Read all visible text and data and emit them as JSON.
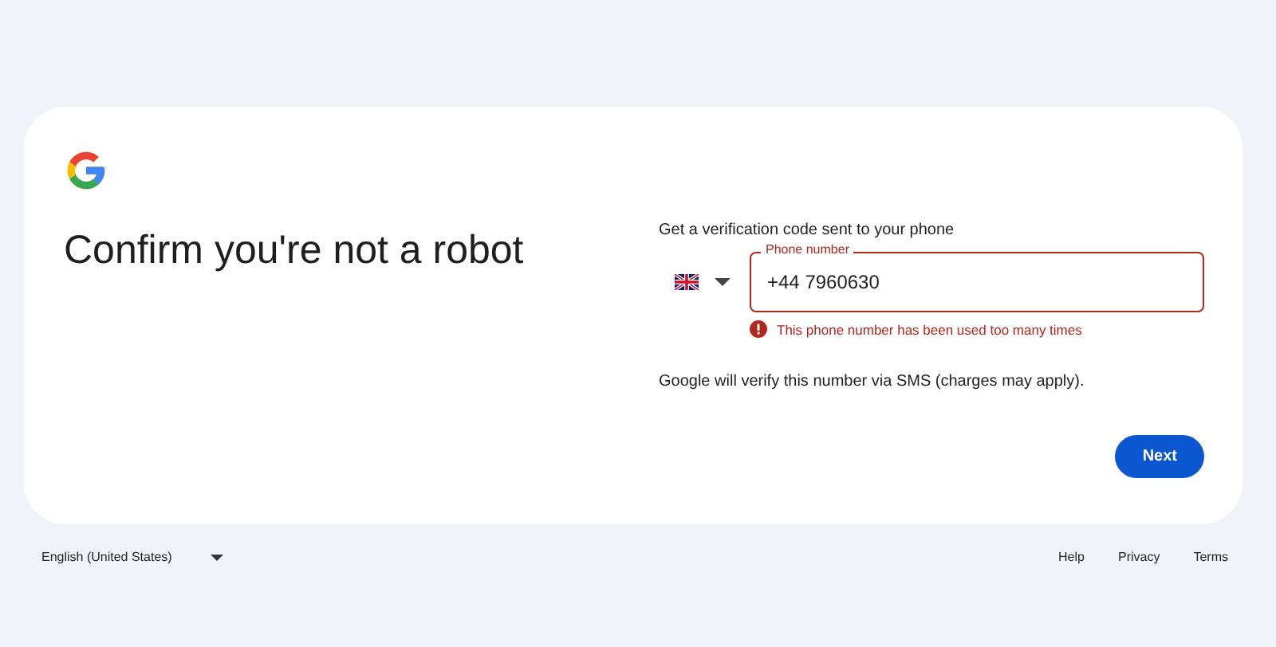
{
  "card": {
    "title": "Confirm you're not a robot",
    "prompt": "Get a verification code sent to your phone",
    "phone_field": {
      "label": "Phone number",
      "value": "+44 7960630",
      "invalid": true,
      "error": "This phone number has been used too many times"
    },
    "note": "Google will verify this number via SMS (charges may apply).",
    "buttons": [
      {
        "label": "Next",
        "kind": "primary"
      }
    ]
  },
  "footer": {
    "language": "English (United States)",
    "links": [
      "Help",
      "Privacy",
      "Terms"
    ]
  }
}
